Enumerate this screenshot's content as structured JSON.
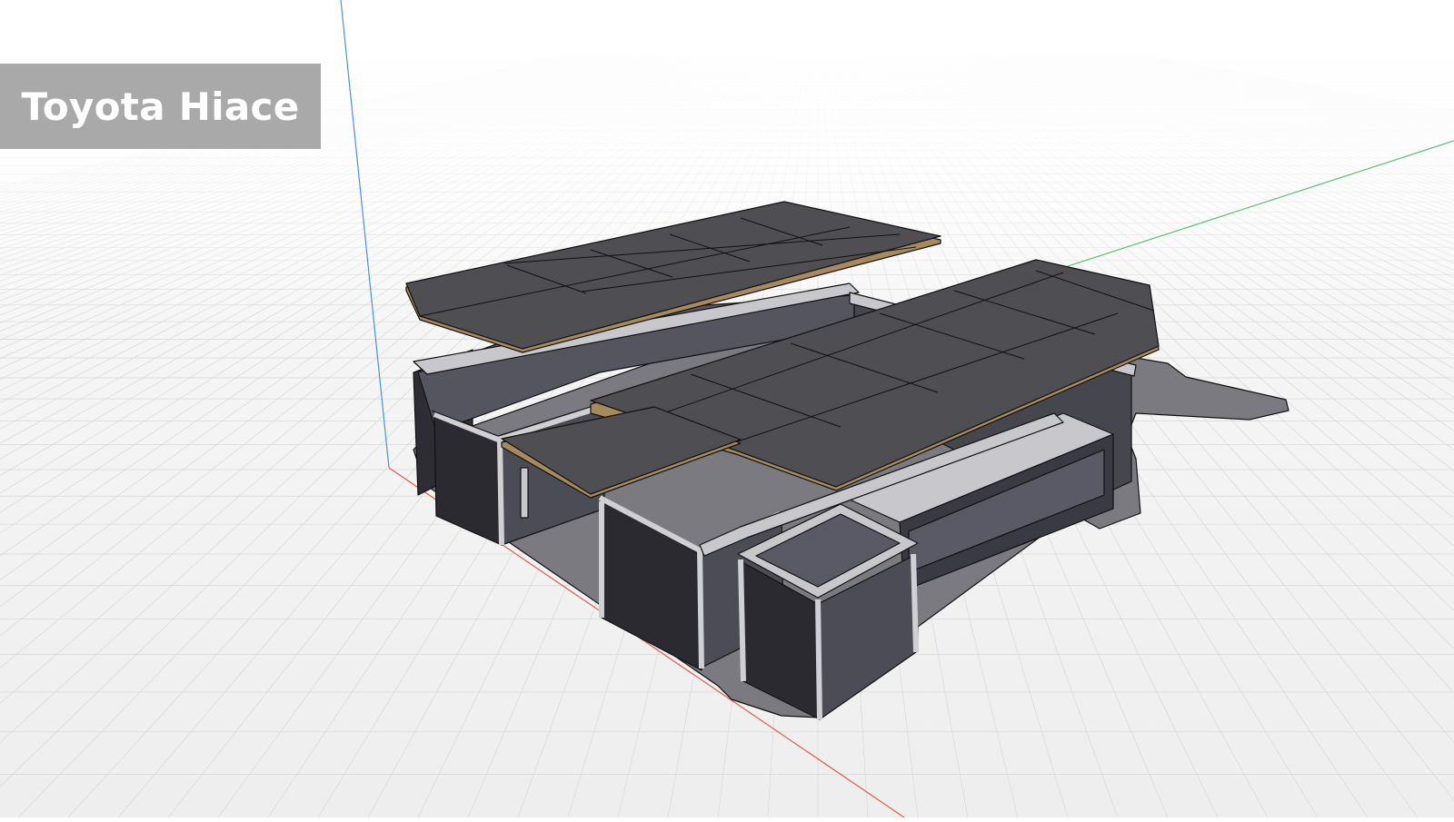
{
  "title": "Toyota Hiace",
  "colors": {
    "background_top": "#ffffff",
    "grid_line": "#d4d4d4",
    "axis_z": "#4a90e2",
    "axis_x": "#e05a4e",
    "axis_y": "#5cbf6f",
    "panel_top": "#4f4e53",
    "panel_edge": "#a8895e",
    "box_dark": "#2b2a30",
    "box_side": "#4a4a55",
    "frame_light": "#c8c8cc",
    "base_plate": "#7a7a80"
  }
}
